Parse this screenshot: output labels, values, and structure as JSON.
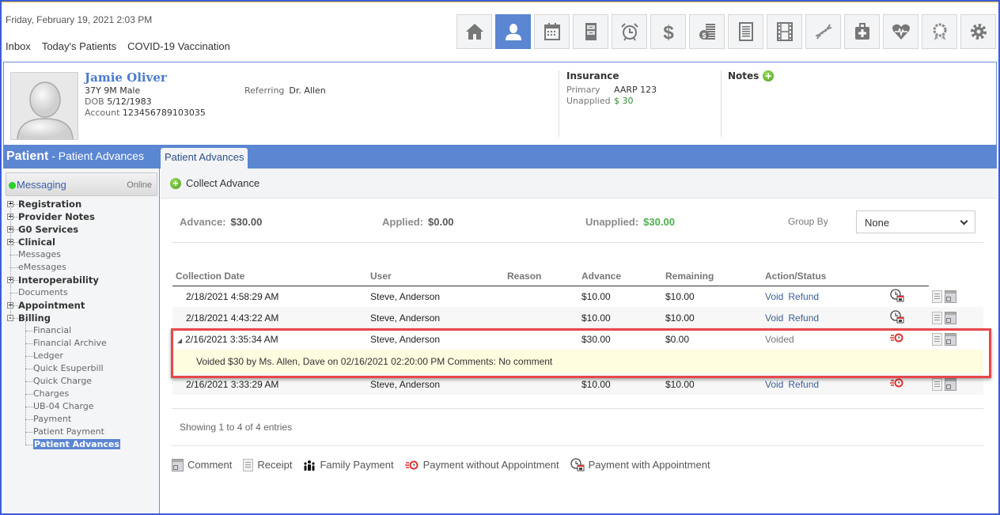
{
  "header": {
    "datetime": "Friday, February 19, 2021  2:03 PM",
    "links": [
      "Inbox",
      "Today's Patients",
      "COVID-19 Vaccination"
    ],
    "toolbar": [
      {
        "icon": "home-icon",
        "active": false
      },
      {
        "icon": "patient-icon",
        "active": true
      },
      {
        "icon": "calendar-icon",
        "active": false
      },
      {
        "icon": "file-cabinet-icon",
        "active": false
      },
      {
        "icon": "alarm-clock-icon",
        "active": false
      },
      {
        "icon": "dollar-icon",
        "active": false
      },
      {
        "icon": "coins-icon",
        "active": false
      },
      {
        "icon": "document-list-icon",
        "active": false
      },
      {
        "icon": "film-icon",
        "active": false
      },
      {
        "icon": "dna-icon",
        "active": false
      },
      {
        "icon": "medical-kit-icon",
        "active": false
      },
      {
        "icon": "heart-pulse-icon",
        "active": false
      },
      {
        "icon": "award-icon",
        "active": false
      },
      {
        "icon": "gear-icon",
        "active": false
      }
    ]
  },
  "patient": {
    "name": "Jamie Oliver",
    "age_sex": "37Y 9M Male",
    "dob_label": "DOB",
    "dob": "5/12/1983",
    "account_label": "Account",
    "account": "123456789103035",
    "referring_label": "Referring",
    "referring": "Dr. Allen",
    "insurance_title": "Insurance",
    "primary_label": "Primary",
    "primary": "AARP 123",
    "unapplied_label": "Unapplied",
    "unapplied": "$ 30",
    "notes_title": "Notes"
  },
  "bar": {
    "title": "Patient",
    "subtitle": " - Patient Advances",
    "tab": "Patient Advances"
  },
  "sidebar": {
    "messaging": "Messaging",
    "status": "Online",
    "items": [
      {
        "label": "Registration",
        "type": "top",
        "exp": "+"
      },
      {
        "label": "Provider Notes",
        "type": "top",
        "exp": "+"
      },
      {
        "label": "G0 Services",
        "type": "top",
        "exp": "+"
      },
      {
        "label": "Clinical",
        "type": "top",
        "exp": "+"
      },
      {
        "label": "Messages",
        "type": "leaf-top"
      },
      {
        "label": "eMessages",
        "type": "leaf-top"
      },
      {
        "label": "Interoperability",
        "type": "top",
        "exp": "+"
      },
      {
        "label": "Documents",
        "type": "leaf-top"
      },
      {
        "label": "Appointment",
        "type": "top",
        "exp": "+"
      },
      {
        "label": "Billing",
        "type": "top",
        "exp": "-"
      },
      {
        "label": "Financial",
        "type": "sub"
      },
      {
        "label": "Financial Archive",
        "type": "sub"
      },
      {
        "label": "Ledger",
        "type": "sub"
      },
      {
        "label": "Quick Esuperbill",
        "type": "sub"
      },
      {
        "label": "Quick Charge",
        "type": "sub"
      },
      {
        "label": "Charges",
        "type": "sub"
      },
      {
        "label": "UB-04 Charge",
        "type": "sub"
      },
      {
        "label": "Payment",
        "type": "sub"
      },
      {
        "label": "Patient Payment",
        "type": "sub"
      },
      {
        "label": "Patient Advances",
        "type": "sub",
        "selected": true
      }
    ]
  },
  "main": {
    "collect_label": "Collect Advance",
    "summary": {
      "advance_label": "Advance:",
      "advance": "$30.00",
      "applied_label": "Applied:",
      "applied": "$0.00",
      "unapplied_label": "Unapplied:",
      "unapplied": "$30.00"
    },
    "group_by_label": "Group By",
    "group_by_value": "None",
    "columns": [
      "Collection Date",
      "User",
      "Reason",
      "Advance",
      "Remaining",
      "Action/Status"
    ],
    "rows": [
      {
        "date": "2/18/2021 4:58:29 AM",
        "user": "Steve, Anderson",
        "reason": "",
        "advance": "$10.00",
        "remaining": "$10.00",
        "actions": [
          "Void",
          "Refund"
        ],
        "status": "",
        "type_icon": "payment-with-appointment-icon"
      },
      {
        "date": "2/18/2021 4:43:22 AM",
        "user": "Steve, Anderson",
        "reason": "",
        "advance": "$10.00",
        "remaining": "$10.00",
        "actions": [
          "Void",
          "Refund"
        ],
        "status": "",
        "type_icon": "payment-with-appointment-icon"
      },
      {
        "date": "2/16/2021 3:35:34 AM",
        "user": "Steve, Anderson",
        "reason": "",
        "advance": "$30.00",
        "remaining": "$0.00",
        "actions": [],
        "status": "Voided",
        "type_icon": "payment-without-appointment-icon",
        "expanded": true,
        "detail": "Voided $30 by Ms. Allen, Dave on 02/16/2021 02:20:00 PM Comments: No comment"
      },
      {
        "date": "2/16/2021 3:33:29 AM",
        "user": "Steve, Anderson",
        "reason": "",
        "advance": "$10.00",
        "remaining": "$10.00",
        "actions": [
          "Void",
          "Refund"
        ],
        "status": "",
        "type_icon": "payment-without-appointment-icon"
      }
    ],
    "showing": "Showing 1 to 4 of 4 entries",
    "legend": [
      "Comment",
      "Receipt",
      "Family Payment",
      "Payment without Appointment",
      "Payment with Appointment"
    ]
  },
  "colors": {
    "accent": "#5b86d1",
    "link": "#3d5f94",
    "green": "#4caf50",
    "highlight": "#e8474a",
    "detail_bg": "#fefde0"
  }
}
